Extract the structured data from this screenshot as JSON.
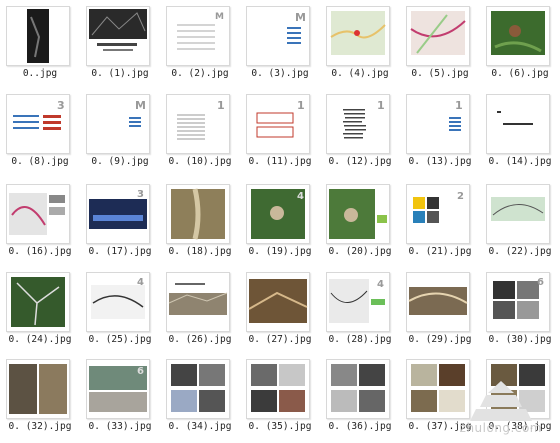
{
  "files": [
    {
      "name": "0..jpg",
      "thumb": "black-photo-1"
    },
    {
      "name": "0. (1).jpg",
      "thumb": "black-photo-2"
    },
    {
      "name": "0. (2).jpg",
      "thumb": "toc-page"
    },
    {
      "name": "0. (3).jpg",
      "thumb": "chapter-page"
    },
    {
      "name": "0. (4).jpg",
      "thumb": "map-light"
    },
    {
      "name": "0. (5).jpg",
      "thumb": "map-road"
    },
    {
      "name": "0. (6).jpg",
      "thumb": "aerial-green"
    },
    {
      "name": "0. (8).jpg",
      "thumb": "red-list"
    },
    {
      "name": "0. (9).jpg",
      "thumb": "chapter-page-2"
    },
    {
      "name": "0. (10).jpg",
      "thumb": "text-list"
    },
    {
      "name": "0. (11).jpg",
      "thumb": "red-box"
    },
    {
      "name": "0. (12).jpg",
      "thumb": "text-stack"
    },
    {
      "name": "0. (13).jpg",
      "thumb": "chapter-page-3"
    },
    {
      "name": "0. (14).jpg",
      "thumb": "title-page"
    },
    {
      "name": "0. (16).jpg",
      "thumb": "site-plan"
    },
    {
      "name": "0. (17).jpg",
      "thumb": "night-render"
    },
    {
      "name": "0. (18).jpg",
      "thumb": "valley-aerial"
    },
    {
      "name": "0. (19).jpg",
      "thumb": "aerial-forest"
    },
    {
      "name": "0. (20).jpg",
      "thumb": "aerial-forest-2"
    },
    {
      "name": "0. (21).jpg",
      "thumb": "color-blocks"
    },
    {
      "name": "0. (22).jpg",
      "thumb": "plan-sketch"
    },
    {
      "name": "0. (24).jpg",
      "thumb": "aerial-dark"
    },
    {
      "name": "0. (25).jpg",
      "thumb": "plan-bw"
    },
    {
      "name": "0. (26).jpg",
      "thumb": "panorama"
    },
    {
      "name": "0. (27).jpg",
      "thumb": "render-brown"
    },
    {
      "name": "0. (28).jpg",
      "thumb": "plan-green"
    },
    {
      "name": "0. (29).jpg",
      "thumb": "panorama-2"
    },
    {
      "name": "0. (30).jpg",
      "thumb": "photo-collage"
    },
    {
      "name": "0. (32).jpg",
      "thumb": "photo-rain"
    },
    {
      "name": "0. (33).jpg",
      "thumb": "photo-water"
    },
    {
      "name": "0. (34).jpg",
      "thumb": "photo-interior"
    },
    {
      "name": "0. (35).jpg",
      "thumb": "photo-collage-2"
    },
    {
      "name": "0. (36).jpg",
      "thumb": "photo-collage-3"
    },
    {
      "name": "0. (37).jpg",
      "thumb": "photo-collage-4"
    },
    {
      "name": "0. (38).jpg",
      "thumb": "photo-collage-5"
    }
  ],
  "watermark": {
    "text": "zhulong.com"
  }
}
